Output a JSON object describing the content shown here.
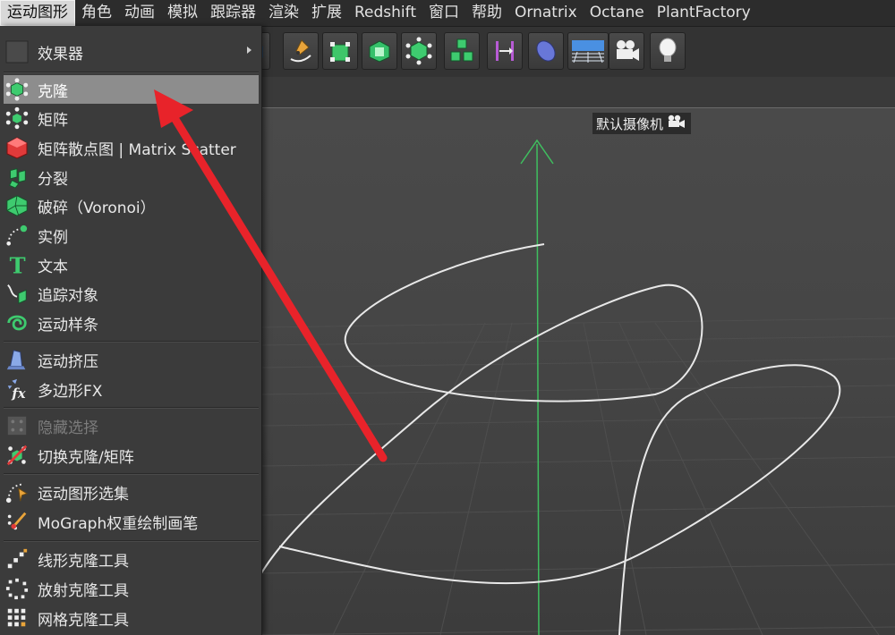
{
  "menubar": {
    "items": [
      "运动图形",
      "角色",
      "动画",
      "模拟",
      "跟踪器",
      "渲染",
      "扩展",
      "Redshift",
      "窗口",
      "帮助",
      "Ornatrix",
      "Octane",
      "PlantFactory"
    ],
    "active_index": 0
  },
  "toolbar": {
    "icons": [
      "cube-primitive-icon",
      "pen-spline-icon",
      "bend-deformer-icon",
      "subdivision-cube-icon",
      "extrude-cube-icon",
      "cloner-cube-icon",
      "instance-cubes-icon",
      "measure-icon",
      "deformer-blob-icon",
      "floor-plane-icon",
      "camera-icon",
      "light-bulb-icon"
    ]
  },
  "viewport": {
    "camera_label": "默认摄像机"
  },
  "dropdown": {
    "effector_label": "效果器",
    "items": [
      {
        "label": "克隆",
        "icon": "cloner-icon",
        "highlight": true
      },
      {
        "label": "矩阵",
        "icon": "matrix-icon"
      },
      {
        "label": "矩阵散点图 | Matrix Scatter",
        "icon": "matrix-scatter-icon"
      },
      {
        "label": "分裂",
        "icon": "fracture-icon"
      },
      {
        "label": "破碎（Voronoi）",
        "icon": "voronoi-fracture-icon"
      },
      {
        "label": "实例",
        "icon": "instance-icon"
      },
      {
        "label": "文本",
        "icon": "text-icon"
      },
      {
        "label": "追踪对象",
        "icon": "tracer-icon"
      },
      {
        "label": "运动样条",
        "icon": "mospline-icon"
      },
      {
        "label": "运动挤压",
        "icon": "extrude-icon"
      },
      {
        "label": "多边形FX",
        "icon": "polyfx-icon"
      },
      {
        "label": "隐藏选择",
        "icon": "hide-selection-icon",
        "disabled": true
      },
      {
        "label": "切换克隆/矩阵",
        "icon": "toggle-clone-matrix-icon"
      },
      {
        "label": "运动图形选集",
        "icon": "mograph-selection-icon"
      },
      {
        "label": "MoGraph权重绘制画笔",
        "icon": "weight-brush-icon"
      },
      {
        "label": "线形克隆工具",
        "icon": "linear-clone-icon"
      },
      {
        "label": "放射克隆工具",
        "icon": "radial-clone-icon"
      },
      {
        "label": "网格克隆工具",
        "icon": "grid-clone-icon"
      }
    ]
  },
  "colors": {
    "highlight": "#8d8d8d",
    "y_axis": "#3fbf5f",
    "arrow": "#e8232a"
  }
}
